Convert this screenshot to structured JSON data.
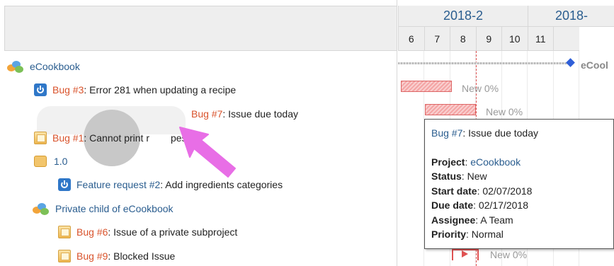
{
  "calendar": {
    "months": [
      "2018-2",
      "2018-"
    ],
    "days": [
      "6",
      "7",
      "8",
      "9",
      "10",
      "11"
    ]
  },
  "tree": [
    {
      "type": "project",
      "label": "eCookbook"
    },
    {
      "type": "issue-blue",
      "tracker": "Bug #3",
      "subject": ": Error 281 when updating a recipe"
    },
    {
      "type": "issue-plain",
      "tracker": "Bug #7",
      "subject": ": Issue due today"
    },
    {
      "type": "issue",
      "tracker": "Bug #1",
      "subject": ": Cannot print recipes",
      "subject_visible": ": Cannot print r",
      "subject_tail": "pes"
    },
    {
      "type": "version",
      "label": "1.0"
    },
    {
      "type": "issue-blue",
      "tracker": "Feature request #2",
      "subject": ": Add ingredients categories"
    },
    {
      "type": "project",
      "label": "Private child of eCookbook"
    },
    {
      "type": "issue",
      "tracker": "Bug #6",
      "subject": ": Issue of a private subproject"
    },
    {
      "type": "issue",
      "tracker": "Bug #9",
      "subject": ": Blocked Issue"
    }
  ],
  "gantt": {
    "project_label": "eCool",
    "bars": [
      {
        "label": "New 0%"
      },
      {
        "label": "New 0%"
      },
      {
        "label": "New 0%"
      }
    ]
  },
  "tooltip": {
    "title_link": "Bug #7",
    "title_text": ": Issue due today",
    "fields": [
      {
        "label": "Project",
        "value": "eCookbook",
        "link": true
      },
      {
        "label": "Status",
        "value": "New"
      },
      {
        "label": "Start date",
        "value": "02/07/2018"
      },
      {
        "label": "Due date",
        "value": "02/17/2018"
      },
      {
        "label": "Assignee",
        "value": "A Team"
      },
      {
        "label": "Priority",
        "value": "Normal"
      }
    ]
  },
  "colors": {
    "link": "#2a5d8f",
    "bug": "#d9532c",
    "today_line": "#e05252",
    "pointer_arrow": "#e86ee6"
  }
}
